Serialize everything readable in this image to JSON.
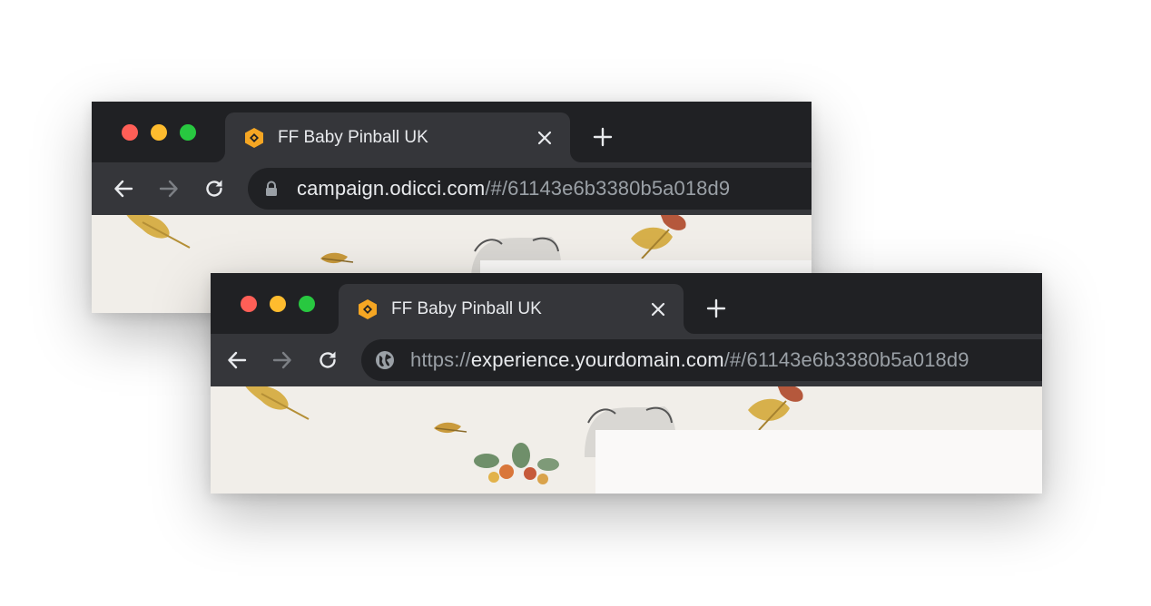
{
  "windows": [
    {
      "id": "campaign",
      "tab": {
        "title": "FF Baby Pinball UK",
        "favicon": "orange-hexagon-icon"
      },
      "address": {
        "security_icon": "lock-icon",
        "scheme": "",
        "host": "campaign.odicci.com",
        "path": "/#/61143e6b3380b5a018d9"
      }
    },
    {
      "id": "experience",
      "tab": {
        "title": "FF Baby Pinball UK",
        "favicon": "orange-hexagon-icon"
      },
      "address": {
        "security_icon": "globe-icon",
        "scheme": "https://",
        "host": "experience.yourdomain.com",
        "path": "/#/61143e6b3380b5a018d9"
      }
    }
  ],
  "colors": {
    "titlebar": "#202124",
    "toolbar": "#35363a",
    "favicon": "#f5a623",
    "page_bg": "#f1eee9"
  }
}
